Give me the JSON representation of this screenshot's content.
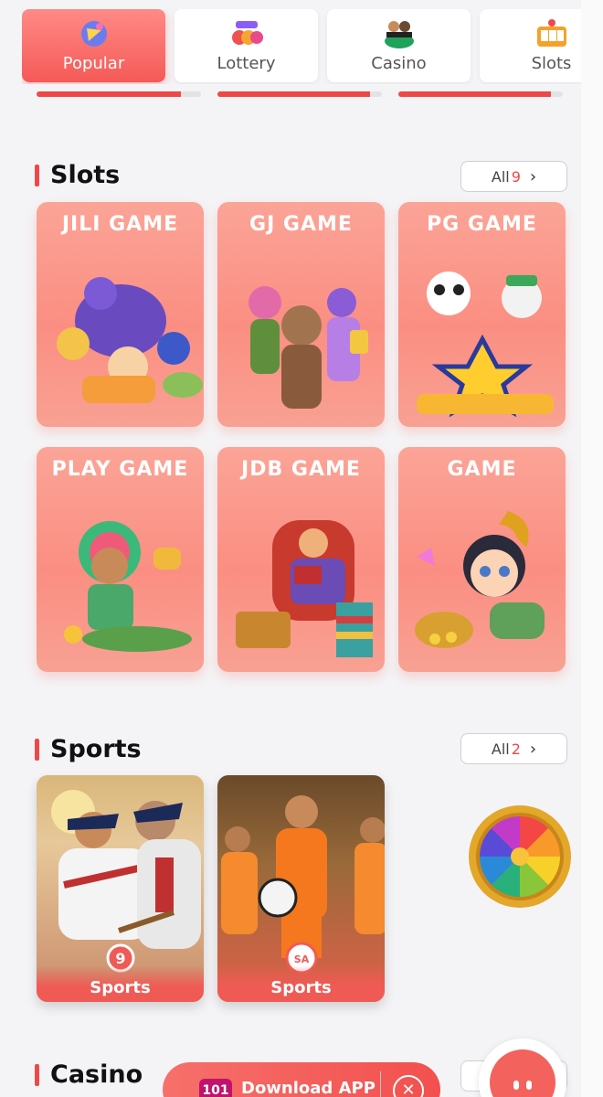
{
  "tabs": [
    {
      "label": "Popular",
      "icon": "popular-icon",
      "active": true
    },
    {
      "label": "Lottery",
      "icon": "lottery-icon",
      "active": false
    },
    {
      "label": "Casino",
      "icon": "casino-icon",
      "active": false
    },
    {
      "label": "Slots",
      "icon": "slots-icon",
      "active": false
    }
  ],
  "progress": [
    0.88,
    0.93,
    0.93
  ],
  "colors": {
    "accent": "#ef4848",
    "card": "#fb8e82"
  },
  "slots": {
    "title": "Slots",
    "all_label": "All",
    "all_count": "9",
    "games": [
      {
        "brand": "JILI GAME"
      },
      {
        "brand": "GJ GAME"
      },
      {
        "brand": "PG GAME"
      },
      {
        "brand": "PLAY GAME"
      },
      {
        "brand": "JDB GAME"
      },
      {
        "brand": "GAME"
      }
    ]
  },
  "sports": {
    "title": "Sports",
    "all_label": "All",
    "all_count": "2",
    "games": [
      {
        "label": "Sports"
      },
      {
        "label": "Sports"
      }
    ]
  },
  "casino": {
    "title": "Casino"
  },
  "download": {
    "label": "Download APP",
    "badge": "101"
  }
}
